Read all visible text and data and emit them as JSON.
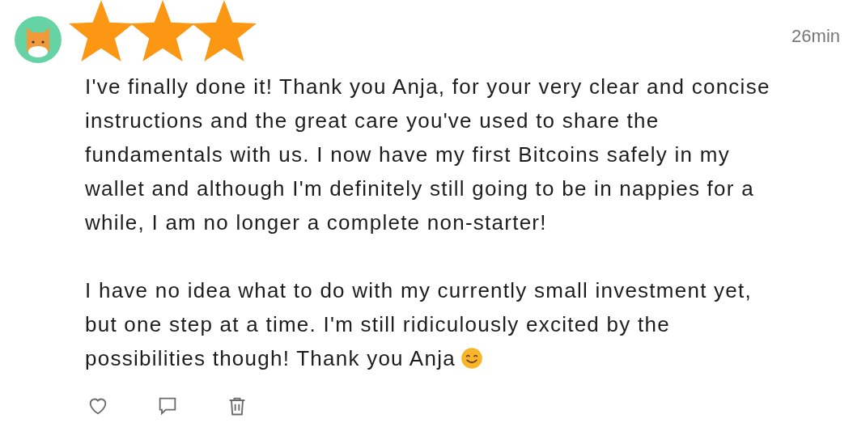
{
  "comment": {
    "name_cover": {
      "stars": 3
    },
    "time": "26min",
    "paragraphs": [
      {
        "text": "I've finally done it! Thank you Anja, for your very clear and concise instructions and the great care you've used to share the fundamentals with us. I now have my first Bitcoins safely in my wallet and although I'm definitely still going to be in nappies for a while, I am no longer a complete non-starter!"
      },
      {
        "text": "I have no idea what to do with my currently small investment yet, but one step at a time. I'm still ridiculously excited by the possibilities though! Thank you Anja",
        "ends_with_smiley": true
      }
    ],
    "actions": [
      {
        "kind": "like"
      },
      {
        "kind": "reply"
      },
      {
        "kind": "delete"
      }
    ]
  }
}
